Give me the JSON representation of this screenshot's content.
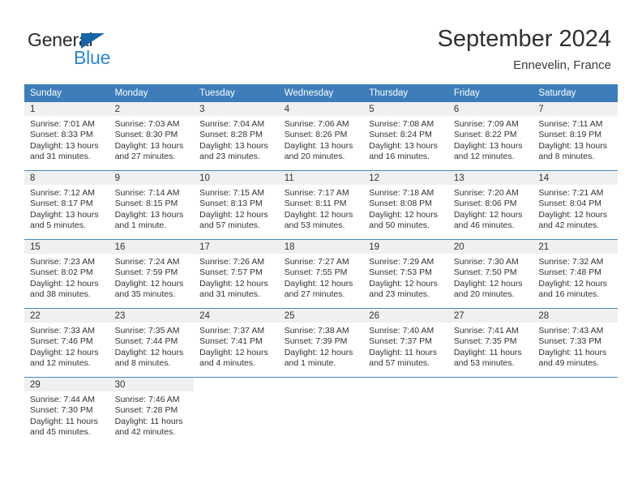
{
  "brand": {
    "name_part1": "General",
    "name_part2": "Blue",
    "triangle_color": "#1565a8",
    "blue_color": "#2b86d4"
  },
  "header": {
    "title": "September 2024",
    "subtitle": "Ennevelin, France"
  },
  "theme": {
    "header_row_bg": "#3c7dba",
    "daynum_band_bg": "#f0f0f0",
    "row_divider": "#4a86c0",
    "text": "#333333"
  },
  "calendar": {
    "weekday_headers": [
      "Sunday",
      "Monday",
      "Tuesday",
      "Wednesday",
      "Thursday",
      "Friday",
      "Saturday"
    ],
    "weeks": [
      [
        {
          "day": "1",
          "sunrise": "Sunrise: 7:01 AM",
          "sunset": "Sunset: 8:33 PM",
          "daylight_line1": "Daylight: 13 hours",
          "daylight_line2": "and 31 minutes."
        },
        {
          "day": "2",
          "sunrise": "Sunrise: 7:03 AM",
          "sunset": "Sunset: 8:30 PM",
          "daylight_line1": "Daylight: 13 hours",
          "daylight_line2": "and 27 minutes."
        },
        {
          "day": "3",
          "sunrise": "Sunrise: 7:04 AM",
          "sunset": "Sunset: 8:28 PM",
          "daylight_line1": "Daylight: 13 hours",
          "daylight_line2": "and 23 minutes."
        },
        {
          "day": "4",
          "sunrise": "Sunrise: 7:06 AM",
          "sunset": "Sunset: 8:26 PM",
          "daylight_line1": "Daylight: 13 hours",
          "daylight_line2": "and 20 minutes."
        },
        {
          "day": "5",
          "sunrise": "Sunrise: 7:08 AM",
          "sunset": "Sunset: 8:24 PM",
          "daylight_line1": "Daylight: 13 hours",
          "daylight_line2": "and 16 minutes."
        },
        {
          "day": "6",
          "sunrise": "Sunrise: 7:09 AM",
          "sunset": "Sunset: 8:22 PM",
          "daylight_line1": "Daylight: 13 hours",
          "daylight_line2": "and 12 minutes."
        },
        {
          "day": "7",
          "sunrise": "Sunrise: 7:11 AM",
          "sunset": "Sunset: 8:19 PM",
          "daylight_line1": "Daylight: 13 hours",
          "daylight_line2": "and 8 minutes."
        }
      ],
      [
        {
          "day": "8",
          "sunrise": "Sunrise: 7:12 AM",
          "sunset": "Sunset: 8:17 PM",
          "daylight_line1": "Daylight: 13 hours",
          "daylight_line2": "and 5 minutes."
        },
        {
          "day": "9",
          "sunrise": "Sunrise: 7:14 AM",
          "sunset": "Sunset: 8:15 PM",
          "daylight_line1": "Daylight: 13 hours",
          "daylight_line2": "and 1 minute."
        },
        {
          "day": "10",
          "sunrise": "Sunrise: 7:15 AM",
          "sunset": "Sunset: 8:13 PM",
          "daylight_line1": "Daylight: 12 hours",
          "daylight_line2": "and 57 minutes."
        },
        {
          "day": "11",
          "sunrise": "Sunrise: 7:17 AM",
          "sunset": "Sunset: 8:11 PM",
          "daylight_line1": "Daylight: 12 hours",
          "daylight_line2": "and 53 minutes."
        },
        {
          "day": "12",
          "sunrise": "Sunrise: 7:18 AM",
          "sunset": "Sunset: 8:08 PM",
          "daylight_line1": "Daylight: 12 hours",
          "daylight_line2": "and 50 minutes."
        },
        {
          "day": "13",
          "sunrise": "Sunrise: 7:20 AM",
          "sunset": "Sunset: 8:06 PM",
          "daylight_line1": "Daylight: 12 hours",
          "daylight_line2": "and 46 minutes."
        },
        {
          "day": "14",
          "sunrise": "Sunrise: 7:21 AM",
          "sunset": "Sunset: 8:04 PM",
          "daylight_line1": "Daylight: 12 hours",
          "daylight_line2": "and 42 minutes."
        }
      ],
      [
        {
          "day": "15",
          "sunrise": "Sunrise: 7:23 AM",
          "sunset": "Sunset: 8:02 PM",
          "daylight_line1": "Daylight: 12 hours",
          "daylight_line2": "and 38 minutes."
        },
        {
          "day": "16",
          "sunrise": "Sunrise: 7:24 AM",
          "sunset": "Sunset: 7:59 PM",
          "daylight_line1": "Daylight: 12 hours",
          "daylight_line2": "and 35 minutes."
        },
        {
          "day": "17",
          "sunrise": "Sunrise: 7:26 AM",
          "sunset": "Sunset: 7:57 PM",
          "daylight_line1": "Daylight: 12 hours",
          "daylight_line2": "and 31 minutes."
        },
        {
          "day": "18",
          "sunrise": "Sunrise: 7:27 AM",
          "sunset": "Sunset: 7:55 PM",
          "daylight_line1": "Daylight: 12 hours",
          "daylight_line2": "and 27 minutes."
        },
        {
          "day": "19",
          "sunrise": "Sunrise: 7:29 AM",
          "sunset": "Sunset: 7:53 PM",
          "daylight_line1": "Daylight: 12 hours",
          "daylight_line2": "and 23 minutes."
        },
        {
          "day": "20",
          "sunrise": "Sunrise: 7:30 AM",
          "sunset": "Sunset: 7:50 PM",
          "daylight_line1": "Daylight: 12 hours",
          "daylight_line2": "and 20 minutes."
        },
        {
          "day": "21",
          "sunrise": "Sunrise: 7:32 AM",
          "sunset": "Sunset: 7:48 PM",
          "daylight_line1": "Daylight: 12 hours",
          "daylight_line2": "and 16 minutes."
        }
      ],
      [
        {
          "day": "22",
          "sunrise": "Sunrise: 7:33 AM",
          "sunset": "Sunset: 7:46 PM",
          "daylight_line1": "Daylight: 12 hours",
          "daylight_line2": "and 12 minutes."
        },
        {
          "day": "23",
          "sunrise": "Sunrise: 7:35 AM",
          "sunset": "Sunset: 7:44 PM",
          "daylight_line1": "Daylight: 12 hours",
          "daylight_line2": "and 8 minutes."
        },
        {
          "day": "24",
          "sunrise": "Sunrise: 7:37 AM",
          "sunset": "Sunset: 7:41 PM",
          "daylight_line1": "Daylight: 12 hours",
          "daylight_line2": "and 4 minutes."
        },
        {
          "day": "25",
          "sunrise": "Sunrise: 7:38 AM",
          "sunset": "Sunset: 7:39 PM",
          "daylight_line1": "Daylight: 12 hours",
          "daylight_line2": "and 1 minute."
        },
        {
          "day": "26",
          "sunrise": "Sunrise: 7:40 AM",
          "sunset": "Sunset: 7:37 PM",
          "daylight_line1": "Daylight: 11 hours",
          "daylight_line2": "and 57 minutes."
        },
        {
          "day": "27",
          "sunrise": "Sunrise: 7:41 AM",
          "sunset": "Sunset: 7:35 PM",
          "daylight_line1": "Daylight: 11 hours",
          "daylight_line2": "and 53 minutes."
        },
        {
          "day": "28",
          "sunrise": "Sunrise: 7:43 AM",
          "sunset": "Sunset: 7:33 PM",
          "daylight_line1": "Daylight: 11 hours",
          "daylight_line2": "and 49 minutes."
        }
      ],
      [
        {
          "day": "29",
          "sunrise": "Sunrise: 7:44 AM",
          "sunset": "Sunset: 7:30 PM",
          "daylight_line1": "Daylight: 11 hours",
          "daylight_line2": "and 45 minutes."
        },
        {
          "day": "30",
          "sunrise": "Sunrise: 7:46 AM",
          "sunset": "Sunset: 7:28 PM",
          "daylight_line1": "Daylight: 11 hours",
          "daylight_line2": "and 42 minutes."
        },
        null,
        null,
        null,
        null,
        null
      ]
    ]
  }
}
